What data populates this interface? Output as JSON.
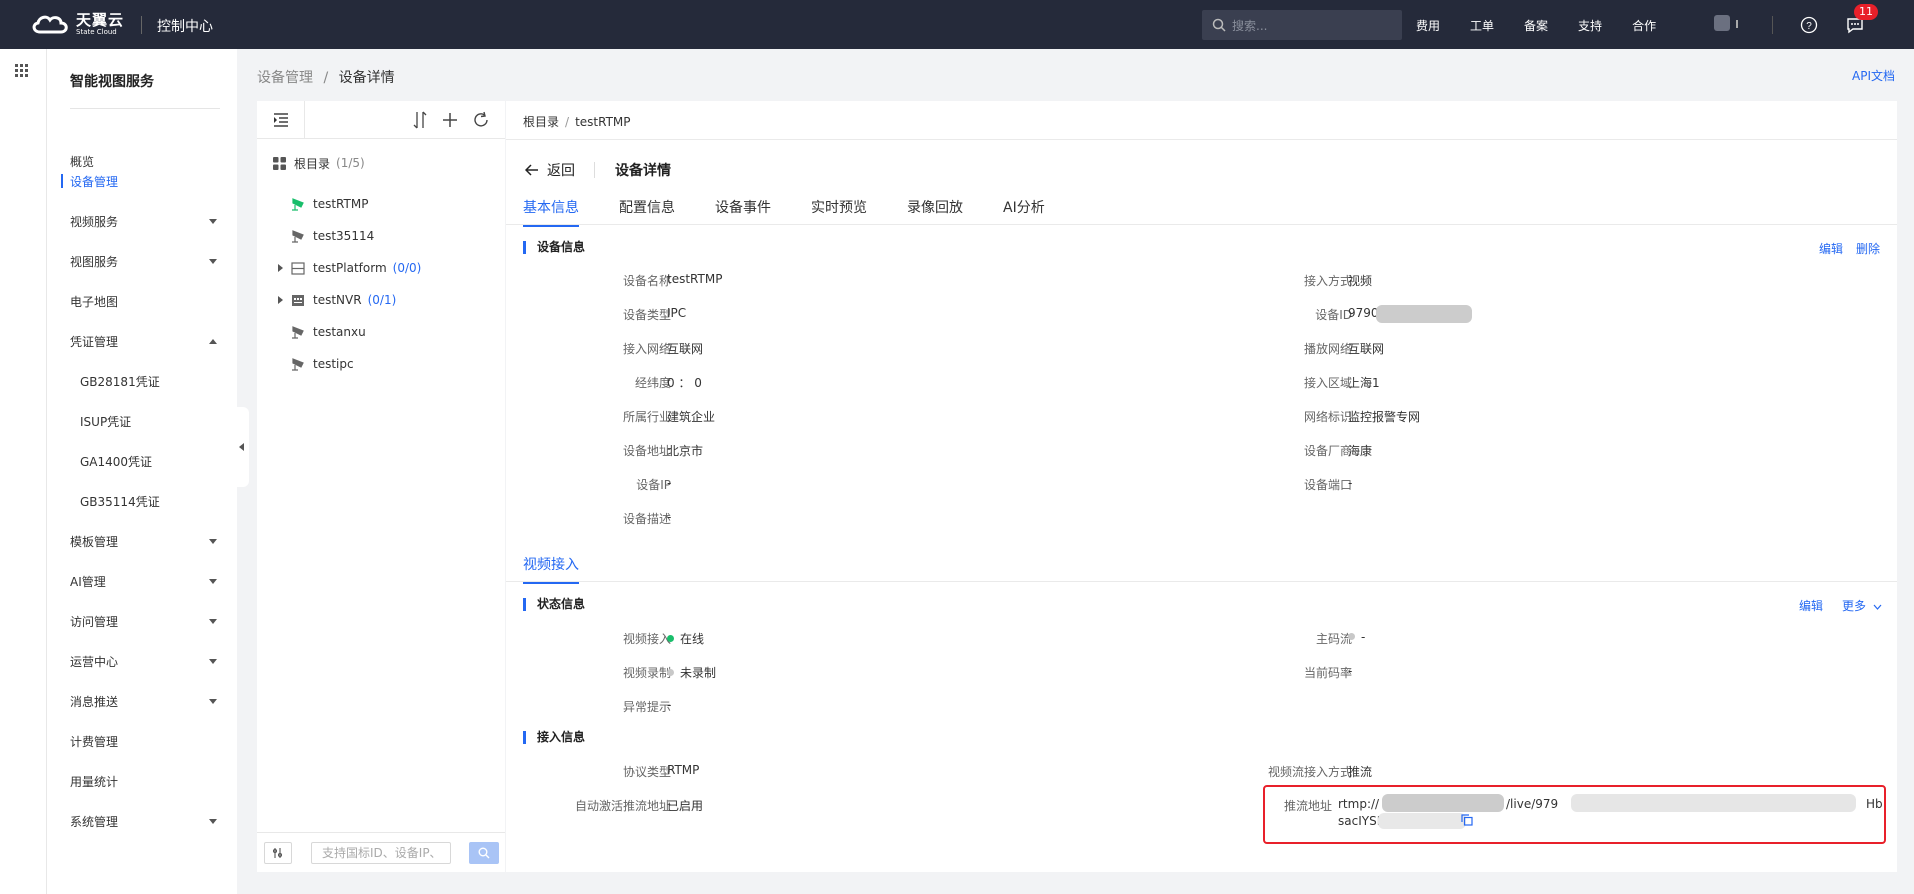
{
  "topbar": {
    "logo_cn": "天翼云",
    "logo_en": "State Cloud",
    "console_title": "控制中心",
    "search_placeholder": "搜索...",
    "links": [
      "费用",
      "工单",
      "备案",
      "支持",
      "合作"
    ],
    "message_badge": "11"
  },
  "sidebar": {
    "title": "智能视图服务",
    "items": [
      {
        "label": "概览"
      },
      {
        "label": "设备管理",
        "active": true
      },
      {
        "label": "视频服务",
        "caret": "down"
      },
      {
        "label": "视图服务",
        "caret": "down"
      },
      {
        "label": "电子地图"
      },
      {
        "label": "凭证管理",
        "caret": "up"
      },
      {
        "label": "GB28181凭证",
        "sub": true
      },
      {
        "label": "ISUP凭证",
        "sub": true
      },
      {
        "label": "GA1400凭证",
        "sub": true
      },
      {
        "label": "GB35114凭证",
        "sub": true
      },
      {
        "label": "模板管理",
        "caret": "down"
      },
      {
        "label": "AI管理",
        "caret": "down"
      },
      {
        "label": "访问管理",
        "caret": "down"
      },
      {
        "label": "运营中心",
        "caret": "down"
      },
      {
        "label": "消息推送",
        "caret": "down"
      },
      {
        "label": "计费管理"
      },
      {
        "label": "用量统计"
      },
      {
        "label": "系统管理",
        "caret": "down"
      }
    ]
  },
  "breadcrumb": {
    "parent": "设备管理",
    "sep": "/",
    "current": "设备详情"
  },
  "api_doc": "API文档",
  "tree": {
    "root_label": "根目录",
    "root_count": "(1/5)",
    "nodes": [
      {
        "label": "testRTMP",
        "icon": "camera-online-icon"
      },
      {
        "label": "test35114",
        "icon": "camera-icon"
      },
      {
        "label": "testPlatform",
        "count": "(0/0)",
        "icon": "platform-icon",
        "expandable": true
      },
      {
        "label": "testNVR",
        "count": "(0/1)",
        "icon": "nvr-icon",
        "expandable": true
      },
      {
        "label": "testanxu",
        "icon": "camera-icon"
      },
      {
        "label": "testipc",
        "icon": "camera-icon"
      }
    ],
    "search_placeholder": "支持国标ID、设备IP、"
  },
  "detail": {
    "crumb_root": "根目录",
    "crumb_sep": "/",
    "crumb_device": "testRTMP",
    "back_label": "返回",
    "page_title": "设备详情",
    "tabs": [
      "基本信息",
      "配置信息",
      "设备事件",
      "实时预览",
      "录像回放",
      "AI分析"
    ],
    "device_info": {
      "title": "设备信息",
      "edit": "编辑",
      "delete": "删除",
      "left": [
        {
          "label": "设备名称",
          "value": "testRTMP"
        },
        {
          "label": "设备类型",
          "value": "IPC"
        },
        {
          "label": "接入网络",
          "value": "互联网"
        },
        {
          "label": "经纬度",
          "value": "0 ： 0"
        },
        {
          "label": "所属行业",
          "value": "建筑企业"
        },
        {
          "label": "设备地址",
          "value": "北京市"
        },
        {
          "label": "设备IP",
          "value": "-"
        },
        {
          "label": "设备描述",
          "value": "-"
        }
      ],
      "right": [
        {
          "label": "接入方式",
          "value": "视频"
        },
        {
          "label": "设备ID",
          "value": "9790"
        },
        {
          "label": "播放网络",
          "value": "互联网"
        },
        {
          "label": "接入区域",
          "value": "上海1"
        },
        {
          "label": "网络标识",
          "value": "监控报警专网"
        },
        {
          "label": "设备厂商",
          "value": "海康"
        },
        {
          "label": "设备端口",
          "value": "-"
        }
      ]
    },
    "sub_tab": "视频接入",
    "status_info": {
      "title": "状态信息",
      "edit": "编辑",
      "more": "更多",
      "video_access_label": "视频接入",
      "video_access_value": "在线",
      "recording_label": "视频录制",
      "recording_value": "未录制",
      "abnormal_label": "异常提示",
      "abnormal_value": "-",
      "main_stream_label": "主码流",
      "main_stream_value": "-",
      "bitrate_label": "当前码率",
      "bitrate_value": "-",
      "online_color": "#19be6b",
      "idle_color": "#c8c8c8"
    },
    "access_info": {
      "title": "接入信息",
      "protocol_label": "协议类型",
      "protocol_value": "RTMP",
      "auto_label": "自动激活推流地址",
      "auto_value": "已启用",
      "stream_mode_label": "视频流接入方式",
      "stream_mode_value": "推流",
      "push_label": "推流地址",
      "push_value_1a": "rtmp://",
      "push_value_1b": "/live/979",
      "push_value_1c": "Hb",
      "push_value_2": "sacIYSMPasXGPQT="
    }
  },
  "colors": {
    "accent": "#2468f2",
    "topbar": "#252a3a",
    "highlight": "#e8202a"
  }
}
